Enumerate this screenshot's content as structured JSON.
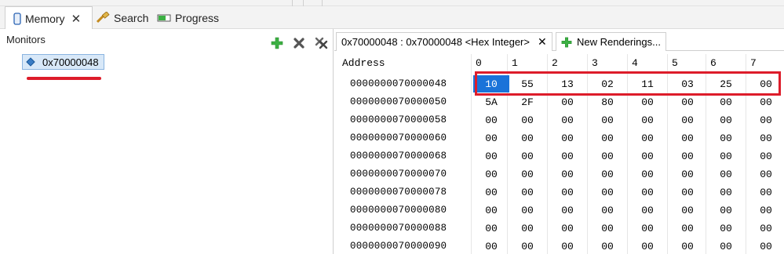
{
  "views": {
    "tabs": [
      {
        "label": "Memory",
        "icon": "memory-icon",
        "active": true
      },
      {
        "label": "Search",
        "icon": "search-icon"
      },
      {
        "label": "Progress",
        "icon": "progress-icon"
      }
    ]
  },
  "monitors": {
    "title": "Monitors",
    "items": [
      {
        "label": "0x70000048"
      }
    ],
    "tools": [
      "add-monitor-icon",
      "remove-monitor-icon",
      "remove-all-monitors-icon"
    ]
  },
  "renderings": {
    "tabs": [
      {
        "label": "0x70000048 : 0x70000048 <Hex Integer>"
      },
      {
        "label": "New Renderings..."
      }
    ],
    "address_header": "Address",
    "column_headers": [
      "0",
      "1",
      "2",
      "3",
      "4",
      "5",
      "6",
      "7"
    ],
    "rows": [
      {
        "address": "0000000070000048",
        "bytes": [
          "10",
          "55",
          "13",
          "02",
          "11",
          "03",
          "25",
          "00"
        ]
      },
      {
        "address": "0000000070000050",
        "bytes": [
          "5A",
          "2F",
          "00",
          "80",
          "00",
          "00",
          "00",
          "00"
        ]
      },
      {
        "address": "0000000070000058",
        "bytes": [
          "00",
          "00",
          "00",
          "00",
          "00",
          "00",
          "00",
          "00"
        ]
      },
      {
        "address": "0000000070000060",
        "bytes": [
          "00",
          "00",
          "00",
          "00",
          "00",
          "00",
          "00",
          "00"
        ]
      },
      {
        "address": "0000000070000068",
        "bytes": [
          "00",
          "00",
          "00",
          "00",
          "00",
          "00",
          "00",
          "00"
        ]
      },
      {
        "address": "0000000070000070",
        "bytes": [
          "00",
          "00",
          "00",
          "00",
          "00",
          "00",
          "00",
          "00"
        ]
      },
      {
        "address": "0000000070000078",
        "bytes": [
          "00",
          "00",
          "00",
          "00",
          "00",
          "00",
          "00",
          "00"
        ]
      },
      {
        "address": "0000000070000080",
        "bytes": [
          "00",
          "00",
          "00",
          "00",
          "00",
          "00",
          "00",
          "00"
        ]
      },
      {
        "address": "0000000070000088",
        "bytes": [
          "00",
          "00",
          "00",
          "00",
          "00",
          "00",
          "00",
          "00"
        ]
      },
      {
        "address": "0000000070000090",
        "bytes": [
          "00",
          "00",
          "00",
          "00",
          "00",
          "00",
          "00",
          "00"
        ]
      }
    ]
  },
  "colors": {
    "selection": "#1a73d9",
    "annotation": "#dd1c2a",
    "add_icon": "#3cb043"
  }
}
